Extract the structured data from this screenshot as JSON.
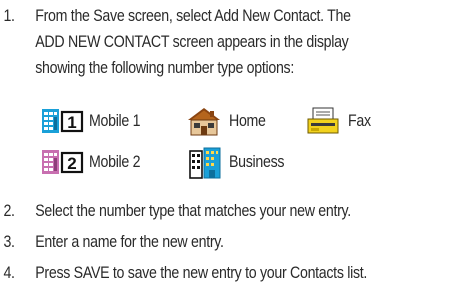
{
  "steps": [
    {
      "number": "1.",
      "lines": [
        "From the Save screen, select Add New Contact. The",
        "ADD NEW CONTACT screen appears in the display",
        "showing the following number type options:"
      ]
    },
    {
      "number": "2.",
      "lines": [
        "Select the number type that matches your new entry."
      ]
    },
    {
      "number": "3.",
      "lines": [
        "Enter a name for the new entry."
      ]
    },
    {
      "number": "4.",
      "lines": [
        "Press SAVE to save the new entry to your Contacts list."
      ]
    }
  ],
  "number_types": [
    {
      "label": "Mobile 1",
      "icon": "mobile-1-icon",
      "color": "#1aa0d8"
    },
    {
      "label": "Home",
      "icon": "home-icon",
      "color": "#b5651d"
    },
    {
      "label": "Fax",
      "icon": "fax-icon",
      "color": "#f2d21e"
    },
    {
      "label": "Mobile 2",
      "icon": "mobile-2-icon",
      "color": "#c86fb0"
    },
    {
      "label": "Business",
      "icon": "business-icon",
      "color": "#1aa0d8"
    }
  ]
}
